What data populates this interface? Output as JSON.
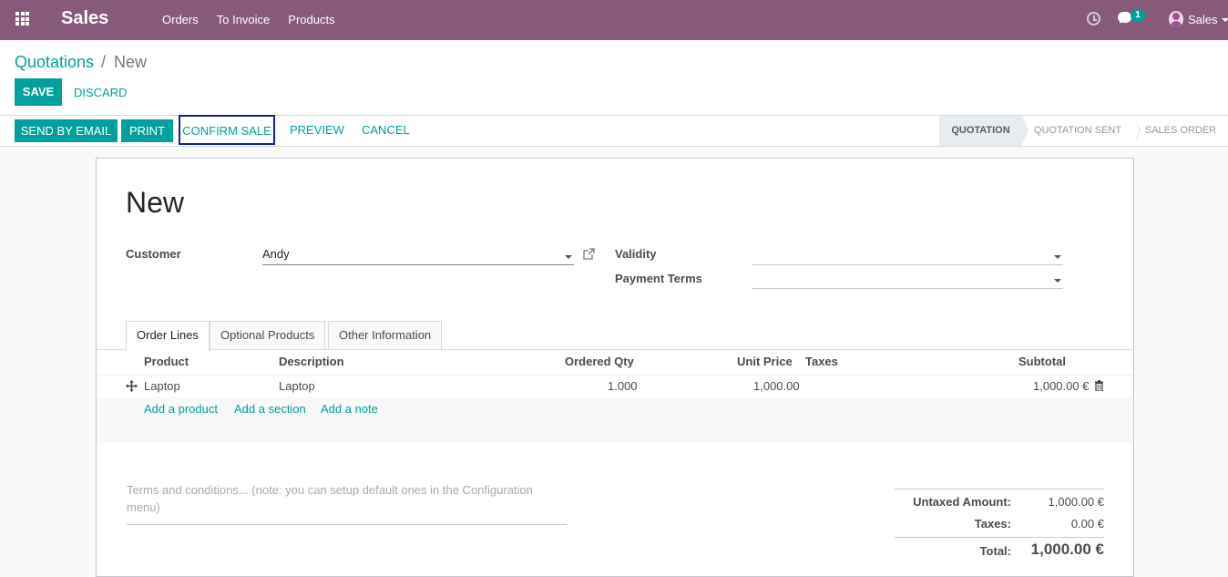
{
  "topbar": {
    "app_name": "Sales",
    "menu": [
      "Orders",
      "To Invoice",
      "Products"
    ],
    "chat_badge": "1",
    "user_name": "Sales"
  },
  "breadcrumb": {
    "parent": "Quotations",
    "separator": "/",
    "current": "New"
  },
  "actions": {
    "save": "SAVE",
    "discard": "DISCARD"
  },
  "statusbar": {
    "send_by_email": "SEND BY EMAIL",
    "print": "PRINT",
    "confirm_sale": "CONFIRM SALE",
    "preview": "PREVIEW",
    "cancel": "CANCEL",
    "stages": [
      "QUOTATION",
      "QUOTATION SENT",
      "SALES ORDER"
    ],
    "active_stage": "QUOTATION"
  },
  "form": {
    "title": "New",
    "customer_label": "Customer",
    "customer_value": "Andy",
    "validity_label": "Validity",
    "validity_value": "",
    "payment_terms_label": "Payment Terms",
    "payment_terms_value": ""
  },
  "tabs": [
    "Order Lines",
    "Optional Products",
    "Other Information"
  ],
  "order_lines": {
    "columns": [
      "Product",
      "Description",
      "Ordered Qty",
      "Unit Price",
      "Taxes",
      "Subtotal"
    ],
    "rows": [
      {
        "product": "Laptop",
        "description": "Laptop",
        "qty": "1.000",
        "unit_price": "1,000.00",
        "taxes": "",
        "subtotal": "1,000.00 €"
      }
    ],
    "add_product": "Add a product",
    "add_section": "Add a section",
    "add_note": "Add a note"
  },
  "terms_placeholder": "Terms and conditions... (note: you can setup default ones in the Configuration menu)",
  "totals": {
    "untaxed_label": "Untaxed Amount:",
    "untaxed_value": "1,000.00 €",
    "taxes_label": "Taxes:",
    "taxes_value": "0.00 €",
    "total_label": "Total:",
    "total_value": "1,000.00 €"
  }
}
